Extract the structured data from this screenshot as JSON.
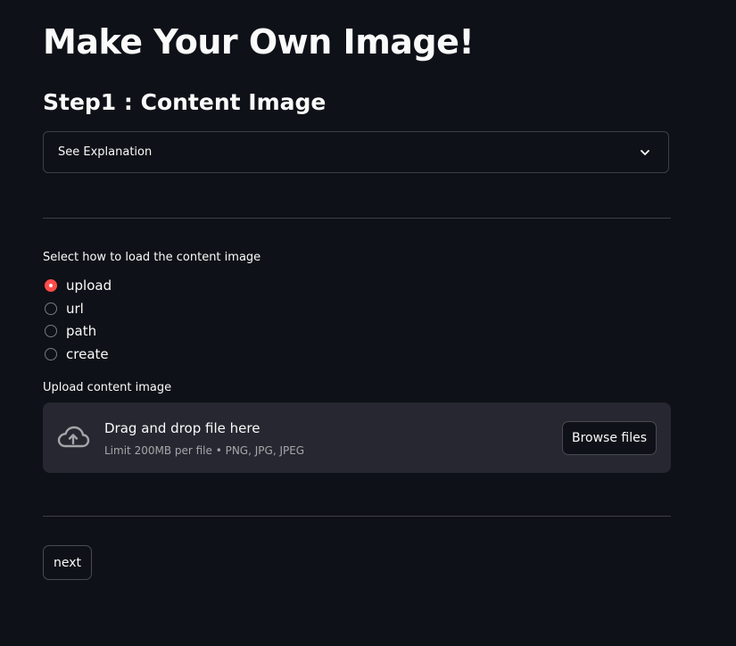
{
  "page": {
    "title": "Make Your Own Image!",
    "step_title": "Step1 : Content Image"
  },
  "expander": {
    "label": "See Explanation",
    "icon": "chevron-down-icon"
  },
  "load_method": {
    "label": "Select how to load the content image",
    "options": [
      {
        "label": "upload",
        "selected": true
      },
      {
        "label": "url",
        "selected": false
      },
      {
        "label": "path",
        "selected": false
      },
      {
        "label": "create",
        "selected": false
      }
    ]
  },
  "uploader": {
    "label": "Upload content image",
    "drop_title": "Drag and drop file here",
    "drop_subtitle": "Limit 200MB per file • PNG, JPG, JPEG",
    "browse_label": "Browse files",
    "icon": "cloud-upload-icon"
  },
  "actions": {
    "next_label": "next"
  },
  "colors": {
    "background": "#0e1117",
    "accent": "#ff4b4b",
    "dropzone": "#262730",
    "text": "#fafafa"
  }
}
